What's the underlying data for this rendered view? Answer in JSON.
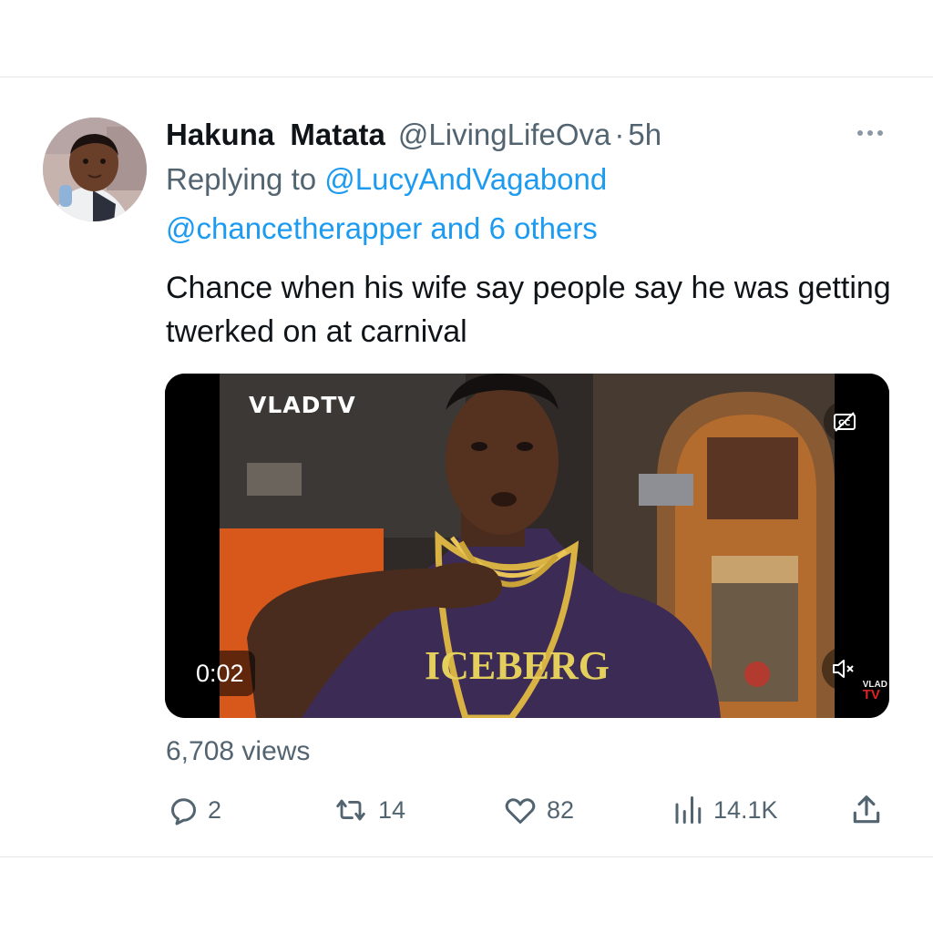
{
  "tweet": {
    "display_name": "Hakuna Matata",
    "handle": "@LivingLifeOva",
    "separator": "·",
    "time": "5h",
    "replying_to_prefix": "Replying to",
    "reply_mention_1": "@LucyAndVagabond",
    "reply_mention_2": "@chancetherapper and 6 others",
    "text": "Chance when his wife say people say he was getting twerked on at carnival",
    "more_icon": "more-horizontal-icon"
  },
  "media": {
    "watermark": "VLADTV",
    "duration": "0:02",
    "shirt_text": "ICEBERG",
    "corner_logo_top": "VLAD",
    "corner_logo_bottom": "TV",
    "cc_icon": "closed-captions-icon",
    "mute_icon": "speaker-muted-icon"
  },
  "stats": {
    "views": "6,708 views"
  },
  "actions": {
    "reply": {
      "icon": "reply-icon",
      "count": "2"
    },
    "retweet": {
      "icon": "retweet-icon",
      "count": "14"
    },
    "like": {
      "icon": "heart-icon",
      "count": "82"
    },
    "views": {
      "icon": "analytics-icon",
      "count": "14.1K"
    },
    "share": {
      "icon": "share-icon"
    }
  },
  "colors": {
    "link": "#1d9bf0",
    "secondary_text": "#536471",
    "primary_text": "#0f1419"
  }
}
